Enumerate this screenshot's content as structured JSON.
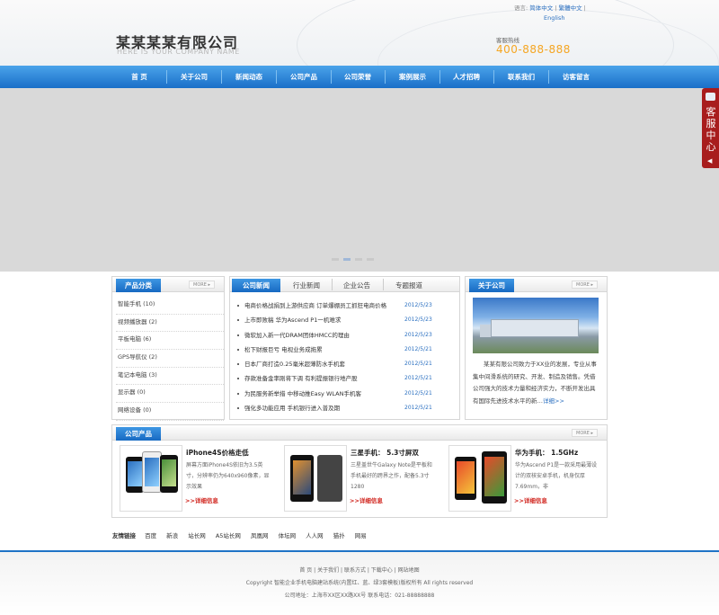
{
  "header": {
    "logo_main": "某某某某有限公司",
    "logo_sub": "HERE IS YOUR COMPANY NAME",
    "lang_label": "语言:",
    "lang_simplified": "简体中文",
    "lang_traditional": "繁體中文",
    "lang_english": "English",
    "hotline_label": "客服热线",
    "hotline_number": "400-888-888"
  },
  "nav": [
    "首  页",
    "关于公司",
    "新闻动态",
    "公司产品",
    "公司荣誉",
    "案例展示",
    "人才招聘",
    "联系我们",
    "访客留言"
  ],
  "side_service": {
    "label": "客服中心"
  },
  "categories": {
    "title": "产品分类",
    "more": "MORE",
    "items": [
      "智能手机 (10)",
      "视频播放器 (2)",
      "平板电脑 (6)",
      "GPS导航仪 (2)",
      "笔记本电脑 (3)",
      "显示器 (0)",
      "网络设备 (0)"
    ]
  },
  "news": {
    "tabs": [
      "公司新闻",
      "行业新闻",
      "企业公告",
      "专题报道"
    ],
    "items": [
      {
        "title": "电商价格战捐到上游供应商 订单爆棚员工抓狂电商价格",
        "date": "2012/5/23"
      },
      {
        "title": "上市即败稿 华为Ascend P1一机难求",
        "date": "2012/5/23"
      },
      {
        "title": "微软加入新一代DRAM团体HMCC的理由",
        "date": "2012/5/23"
      },
      {
        "title": "松下财报巨亏 电视业务成拖累",
        "date": "2012/5/21"
      },
      {
        "title": "日本厂商打造0.25毫米超薄防水手机套",
        "date": "2012/5/21"
      },
      {
        "title": "存款准备金率刚将下调 有利提振银行地产股",
        "date": "2012/5/21"
      },
      {
        "title": "为民服务新举措 中移动推Easy WLAN手机客",
        "date": "2012/5/21"
      },
      {
        "title": "强化多功能应用 手机银行进入普及期",
        "date": "2012/5/21"
      }
    ]
  },
  "about": {
    "title": "关于公司",
    "more": "MORE",
    "text": "某某有限公司致力于XX业的发展，专业从事集中间滑系统的研究、开发、制造及销售。凭借公司强大的技术力量和经济实力，不断开发出具有国际先进技术水平的新…",
    "detail_link": "详细>>"
  },
  "products": {
    "title": "公司产品",
    "more": "MORE",
    "items": [
      {
        "name": "iPhone4S价格走低",
        "desc": "屏幕方面iPhone4S依旧为3.5英寸，分辨率仍为640x960像素，显示效果",
        "more": ">>详细信息"
      },
      {
        "name": "三星手机： 5.3寸屏双",
        "desc": "三星盖世牛Galaxy Note是平板和手机最好的跨界之作，配备5.3寸1280",
        "more": ">>详细信息"
      },
      {
        "name": "华为手机： 1.5GHz",
        "desc": "华为Ascend P1是一款采用最薄设计的双核安卓手机，机身仅厚7.69mm，非",
        "more": ">>详细信息"
      }
    ]
  },
  "friend_links": {
    "label": "友情链接",
    "items": [
      "百度",
      "新浪",
      "站长网",
      "A5站长网",
      "凤凰网",
      "体坛网",
      "人人网",
      "猫扑",
      "网易"
    ]
  },
  "footer": {
    "nav": [
      "首 页",
      "关于我们",
      "联系方式",
      "下载中心",
      "网站地图"
    ],
    "copyright": "Copyright 智能企业手机电脑建站系统(内置红、蓝、绿3套模板)版权所有 All rights reserved",
    "address": "公司地址：上海市XX区XX路XX号  联系电话：021-88888888"
  },
  "colors": {
    "nav_blue": "#1f73c6",
    "hotline": "#f5a623",
    "detail_red": "#d0231c",
    "link_blue": "#2a6fc0"
  }
}
